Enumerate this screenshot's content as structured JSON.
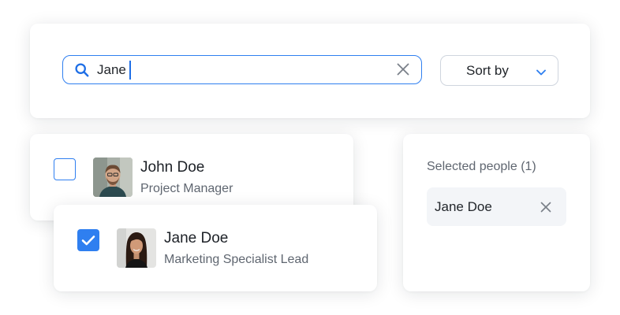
{
  "search": {
    "value": "Jane",
    "icon": "search-icon",
    "clear_icon": "close-icon"
  },
  "sort": {
    "label": "Sort by",
    "icon": "chevron-down-icon"
  },
  "people": [
    {
      "name": "John Doe",
      "role": "Project Manager",
      "selected": false
    },
    {
      "name": "Jane Doe",
      "role": "Marketing Specialist Lead",
      "selected": true
    }
  ],
  "selected_panel": {
    "title": "Selected people (1)",
    "items": [
      {
        "label": "Jane Doe",
        "remove_icon": "close-icon"
      }
    ]
  },
  "colors": {
    "accent": "#2f7ff0",
    "text_primary": "#1d2127",
    "text_secondary": "#5f6670",
    "chip_bg": "#f3f5f8"
  }
}
